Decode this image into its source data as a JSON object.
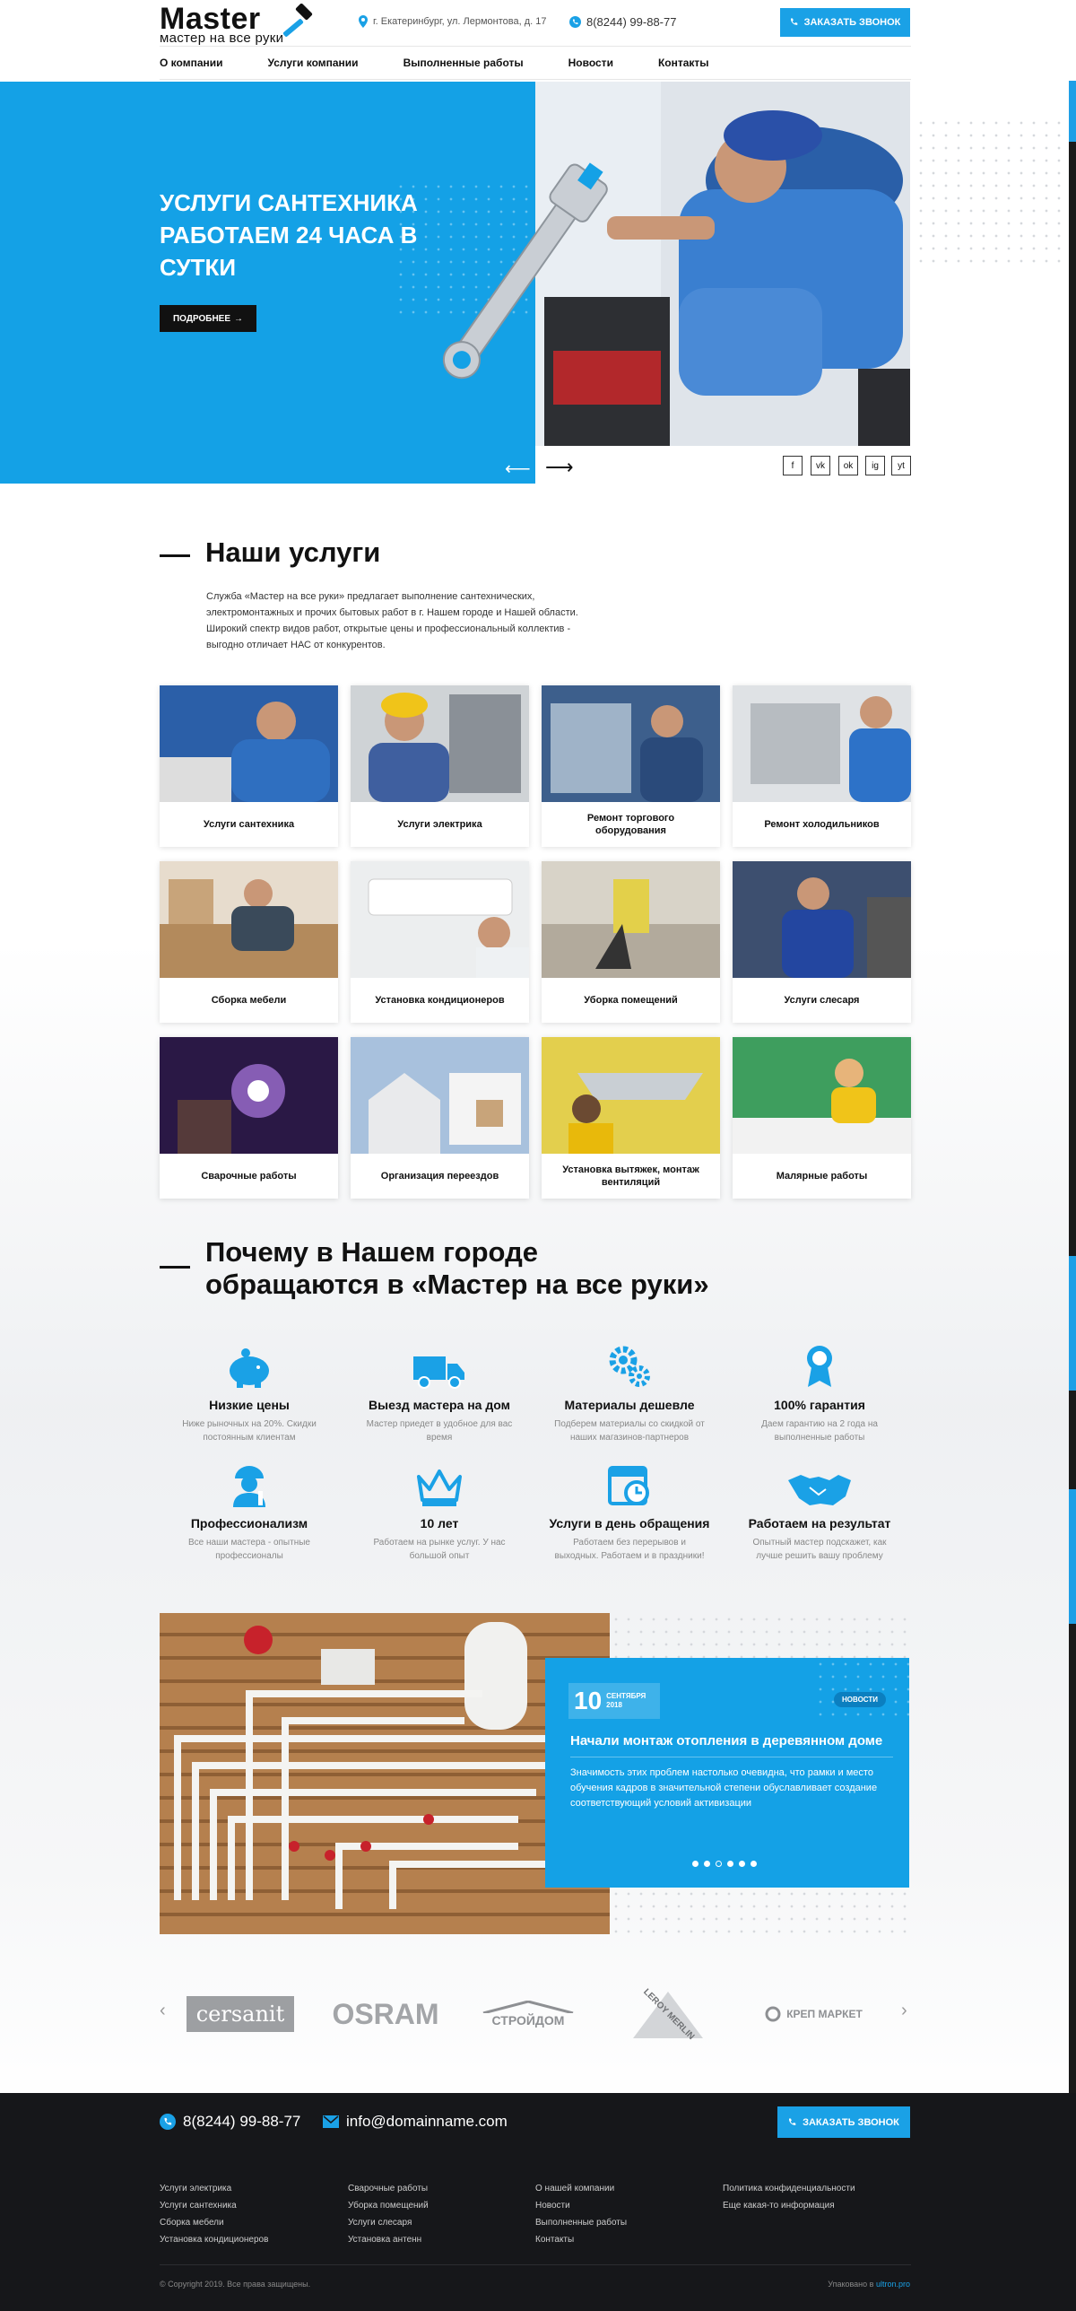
{
  "header": {
    "logo_word": "Master",
    "logo_sub": "мастер на все руки",
    "address": "г. Екатеринбург, ул. Лермонтова, д. 17",
    "phone": "8(8244) 99-88-77",
    "call_button": "ЗАКАЗАТЬ ЗВОНОК"
  },
  "nav": {
    "items": [
      "О компании",
      "Услуги компании",
      "Выполненные работы",
      "Новости",
      "Контакты"
    ]
  },
  "hero": {
    "title": "УСЛУГИ САНТЕХНИКА РАБОТАЕМ 24 ЧАСА В СУТКИ",
    "button": "ПОДРОБНЕЕ",
    "arrow_prev": "⟵",
    "arrow_next": "⟶",
    "social": [
      "f",
      "vk",
      "ok",
      "ig",
      "yt"
    ]
  },
  "services": {
    "title": "Наши услуги",
    "description": "Служба «Мастер на все руки» предлагает выполнение сантехнических, электромонтажных и прочих бытовых работ в г. Нашем городе и Нашей области. Широкий спектр видов работ, открытые цены и профессиональный коллектив - выгодно отличает НАС от конкурентов.",
    "items": [
      {
        "label": "Услуги сантехника",
        "bg": "#2b5fa8"
      },
      {
        "label": "Услуги электрика",
        "bg": "#6f7b86"
      },
      {
        "label": "Ремонт торгового оборудования",
        "bg": "#3d5f8c"
      },
      {
        "label": "Ремонт холодильников",
        "bg": "#9aa3ab"
      },
      {
        "label": "Сборка мебели",
        "bg": "#b38a5c"
      },
      {
        "label": "Установка кондиционеров",
        "bg": "#d9dcdf"
      },
      {
        "label": "Уборка помещений",
        "bg": "#a59f93"
      },
      {
        "label": "Услуги слесаря",
        "bg": "#48577a"
      },
      {
        "label": "Сварочные работы",
        "bg": "#4a2a6a"
      },
      {
        "label": "Организация переездов",
        "bg": "#8fa7c2"
      },
      {
        "label": "Установка вытяжек, монтаж вентиляций",
        "bg": "#d8c24a"
      },
      {
        "label": "Малярные работы",
        "bg": "#3e9e5e"
      }
    ]
  },
  "why": {
    "title_line1": "Почему в Нашем городе",
    "title_line2": "обращаются в «Мастер на все руки»",
    "items": [
      {
        "icon": "piggy-bank-icon",
        "title": "Низкие цены",
        "text": "Ниже рыночных на 20%. Скидки постоянным клиентам"
      },
      {
        "icon": "truck-icon",
        "title": "Выезд мастера на дом",
        "text": "Мастер приедет в удобное для вас время"
      },
      {
        "icon": "gears-icon",
        "title": "Материалы дешевле",
        "text": "Подберем материалы со скидкой от наших магазинов-партнеров"
      },
      {
        "icon": "award-icon",
        "title": "100% гарантия",
        "text": "Даем гарантию на 2 года на выполненные работы"
      },
      {
        "icon": "worker-icon",
        "title": "Профессионализм",
        "text": "Все наши мастера - опытные профессионалы"
      },
      {
        "icon": "crown-icon",
        "title": "10 лет",
        "text": "Работаем на рынке услуг. У нас большой опыт"
      },
      {
        "icon": "calendar-clock-icon",
        "title": "Услуги в день обращения",
        "text": "Работаем без перерывов и выходных. Работаем и в праздники!"
      },
      {
        "icon": "handshake-icon",
        "title": "Работаем на результат",
        "text": "Опытный мастер подскажет, как лучше решить вашу проблему"
      }
    ]
  },
  "news": {
    "day": "10",
    "month": "СЕНТЯБРЯ",
    "year": "2018",
    "badge": "НОВОСТИ",
    "title": "Начали монтаж отопления в деревянном доме",
    "text": "Значимость этих проблем настолько очевидна, что рамки и место обучения кадров в значительной степени обуславливает создание соответствующий условий активизации"
  },
  "partners": {
    "prev": "‹",
    "next": "›",
    "items": [
      "cersanit",
      "OSRAM",
      "СТРОЙДОМ",
      "LEROY MERLIN",
      "КРЕП МАРКЕТ"
    ]
  },
  "footer": {
    "phone": "8(8244) 99-88-77",
    "email": "info@domainname.com",
    "call_button": "ЗАКАЗАТЬ ЗВОНОК",
    "col1": [
      "Услуги электрика",
      "Услуги сантехника",
      "Сборка мебели",
      "Установка кондиционеров"
    ],
    "col2": [
      "Сварочные работы",
      "Уборка помещений",
      "Услуги слесаря",
      "Установка антенн"
    ],
    "col3": [
      "О нашей компании",
      "Новости",
      "Выполненные работы",
      "Контакты"
    ],
    "col4": [
      "Политика конфиденциальности",
      "Еще какая-то информация"
    ],
    "copyright": "© Copyright 2019. Все права защищены.",
    "made_by_prefix": "Упаковано в",
    "made_by_link": "ultron.pro"
  },
  "colors": {
    "accent": "#14a1e6",
    "dark": "#16171a"
  }
}
